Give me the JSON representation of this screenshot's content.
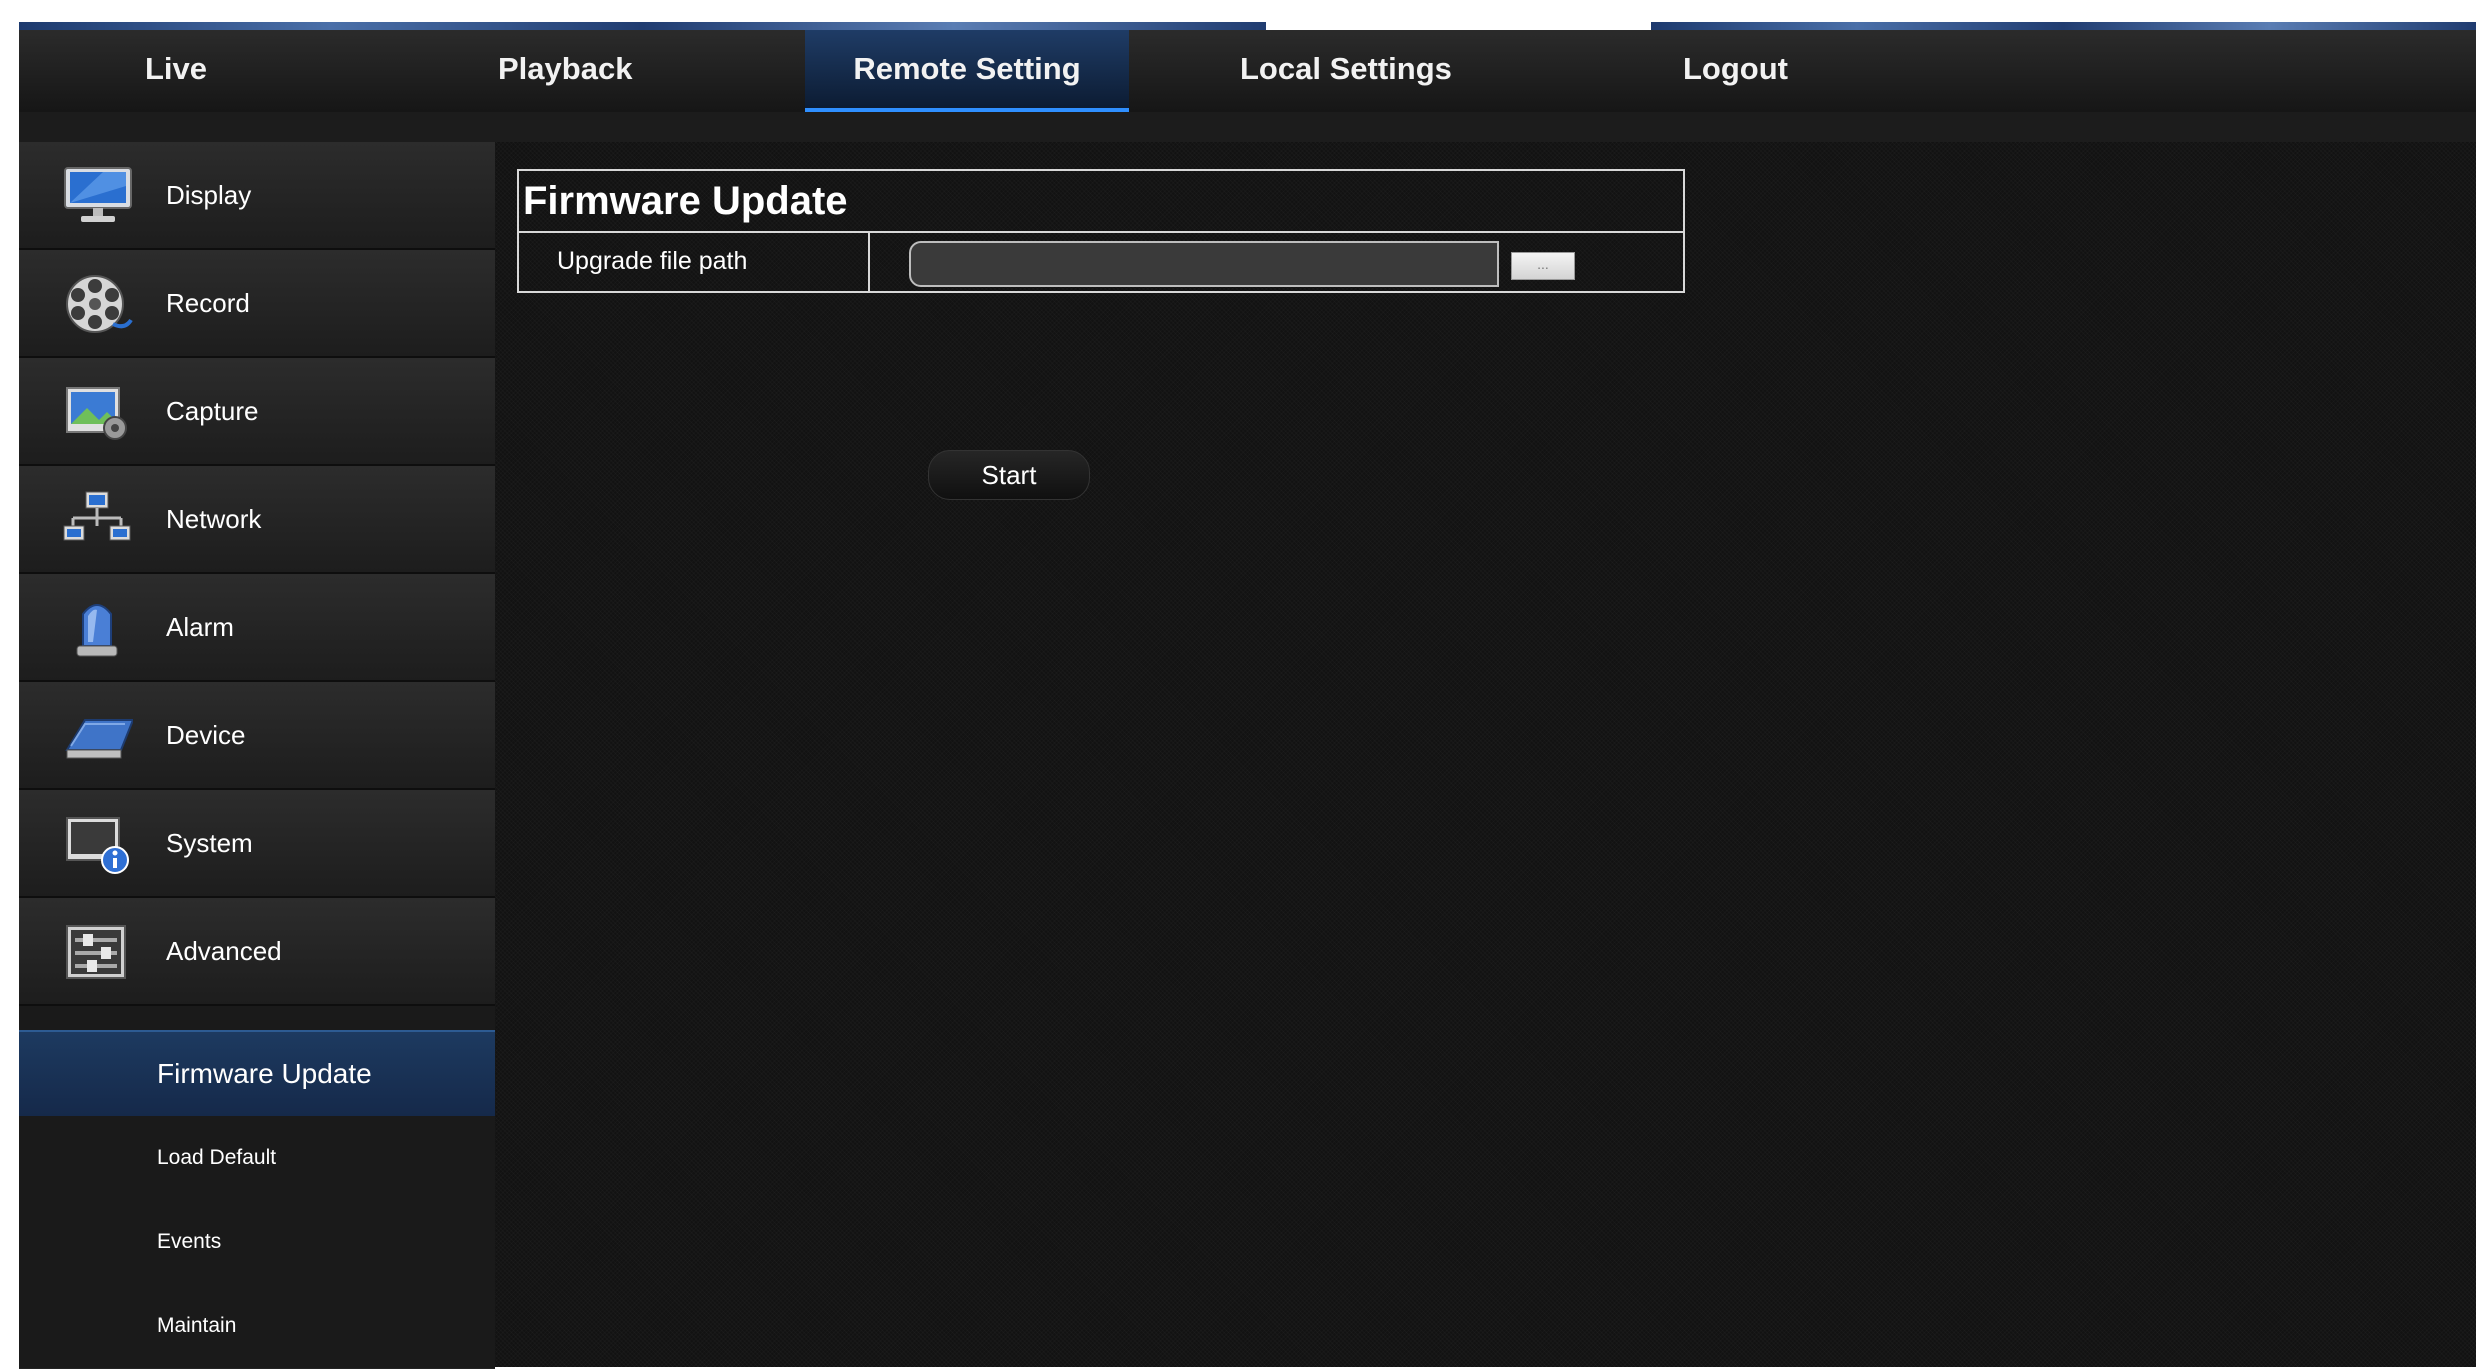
{
  "nav": {
    "tabs": [
      {
        "label": "Live"
      },
      {
        "label": "Playback"
      },
      {
        "label": "Remote Setting"
      },
      {
        "label": "Local Settings"
      },
      {
        "label": "Logout"
      }
    ],
    "active_tab": "Remote Setting"
  },
  "sidebar": {
    "items": [
      {
        "label": "Display",
        "icon": "monitor-icon"
      },
      {
        "label": "Record",
        "icon": "film-reel-icon"
      },
      {
        "label": "Capture",
        "icon": "capture-settings-icon"
      },
      {
        "label": "Network",
        "icon": "network-icon"
      },
      {
        "label": "Alarm",
        "icon": "alarm-beacon-icon"
      },
      {
        "label": "Device",
        "icon": "hard-drive-icon"
      },
      {
        "label": "System",
        "icon": "system-info-icon"
      },
      {
        "label": "Advanced",
        "icon": "sliders-icon"
      }
    ],
    "subitems": [
      {
        "label": "Firmware Update"
      },
      {
        "label": "Load Default"
      },
      {
        "label": "Events"
      },
      {
        "label": "Maintain"
      }
    ],
    "active_subitem": "Firmware Update"
  },
  "main": {
    "title": "Firmware Update",
    "path_label": "Upgrade file path",
    "path_value": "",
    "browse_label": "...",
    "start_label": "Start"
  },
  "colors": {
    "accent": "#2f8fff",
    "active_bg": "#1d3a60",
    "background": "#121212"
  }
}
